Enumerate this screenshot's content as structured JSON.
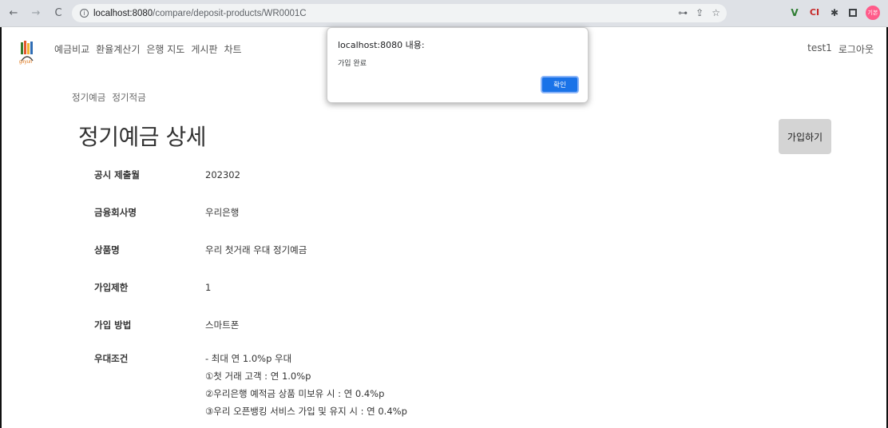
{
  "browser": {
    "url_host": "localhost:8080",
    "url_path": "/compare/deposit-products/WR0001C",
    "profile_label": "기본"
  },
  "app": {
    "logo_text": "giryun",
    "nav": [
      "예금비교",
      "환율계산기",
      "은행 지도",
      "게시판",
      "차트"
    ],
    "user": "test1",
    "logout": "로그아웃",
    "subnav": [
      "정기예금",
      "정기적금"
    ],
    "page_title": "정기예금 상세",
    "join_button": "가입하기"
  },
  "details": [
    {
      "label": "공시 제출월",
      "value": "202302"
    },
    {
      "label": "금융회사명",
      "value": "우리은행"
    },
    {
      "label": "상품명",
      "value": "우리 첫거래 우대 정기예금"
    },
    {
      "label": "가입제한",
      "value": "1"
    },
    {
      "label": "가입 방법",
      "value": "스마트폰"
    }
  ],
  "preferential": {
    "label": "우대조건",
    "lines": [
      "- 최대 연 1.0%p 우대",
      "①첫 거래 고객 : 연 1.0%p",
      "②우리은행 예적금 상품 미보유 시 : 연 0.4%p",
      "③우리 오픈뱅킹 서비스 가입 및 유지 시 : 연 0.4%p"
    ]
  },
  "alert": {
    "title": "localhost:8080 내용:",
    "message": "가입 완료",
    "ok": "확인"
  },
  "colors": {
    "accent": "#1a73e8",
    "join_button_bg": "#d4d4d4"
  }
}
